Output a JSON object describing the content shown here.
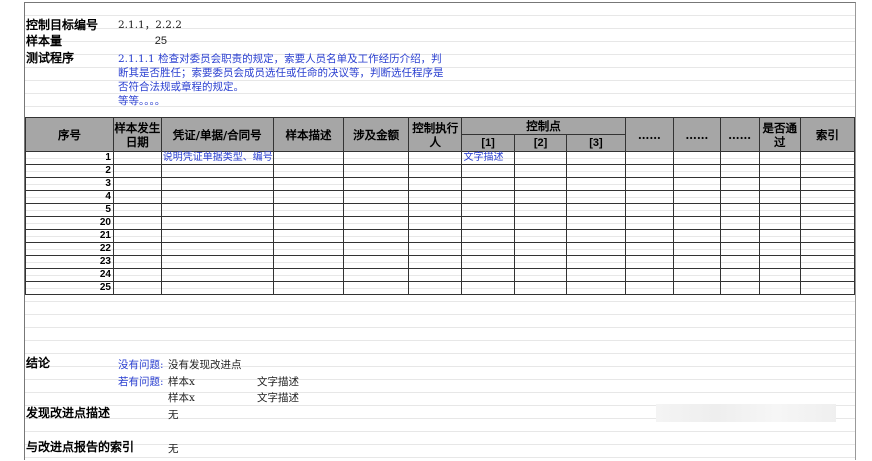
{
  "header": {
    "objective_label": "控制目标编号",
    "objective_value": "2.1.1，2.2.2",
    "sample_label": "样本量",
    "sample_value": "25",
    "procedure_label": "测试程序",
    "procedure_lines": [
      "2.1.1.1 检查对委员会职责的规定，索要人员名单及工作经历介绍，判",
      "断其是否胜任；索要委员会成员选任或任命的决议等，判断选任程序是",
      "否符合法规或章程的规定。",
      "等等。。。。"
    ]
  },
  "table": {
    "columns": {
      "seq": "序号",
      "sample_date": "样本发生日期",
      "voucher": "凭证/单据/合同号",
      "description": "样本描述",
      "amount": "涉及金额",
      "executor": "控制执行人",
      "control_point": "控制点",
      "cp1": "[1]",
      "cp2": "[2]",
      "cp3": "[3]",
      "dots1": "……",
      "dots2": "……",
      "dots3": "……",
      "pass": "是否通过",
      "index": "索引"
    },
    "rows": [
      {
        "num": "1",
        "voucher": "说明凭证单据类型、编号",
        "cp1": "文字描述"
      },
      {
        "num": "2",
        "voucher": "",
        "cp1": ""
      },
      {
        "num": "3",
        "voucher": "",
        "cp1": ""
      },
      {
        "num": "4",
        "voucher": "",
        "cp1": ""
      },
      {
        "num": "5",
        "voucher": "",
        "cp1": ""
      },
      {
        "num": "20",
        "voucher": "",
        "cp1": ""
      },
      {
        "num": "21",
        "voucher": "",
        "cp1": ""
      },
      {
        "num": "22",
        "voucher": "",
        "cp1": ""
      },
      {
        "num": "23",
        "voucher": "",
        "cp1": ""
      },
      {
        "num": "24",
        "voucher": "",
        "cp1": ""
      },
      {
        "num": "25",
        "voucher": "",
        "cp1": ""
      }
    ]
  },
  "conclusion": {
    "label": "结论",
    "no_issue_label": "没有问题:",
    "no_issue_text": "没有发现改进点",
    "issue_label": "若有问题:",
    "items": [
      {
        "sample": "样本x",
        "desc": "文字描述"
      },
      {
        "sample": "样本x",
        "desc": "文字描述"
      }
    ]
  },
  "improvement": {
    "label": "发现改进点描述",
    "value": "无"
  },
  "report_index": {
    "label": "与改进点报告的索引",
    "value": "无"
  }
}
